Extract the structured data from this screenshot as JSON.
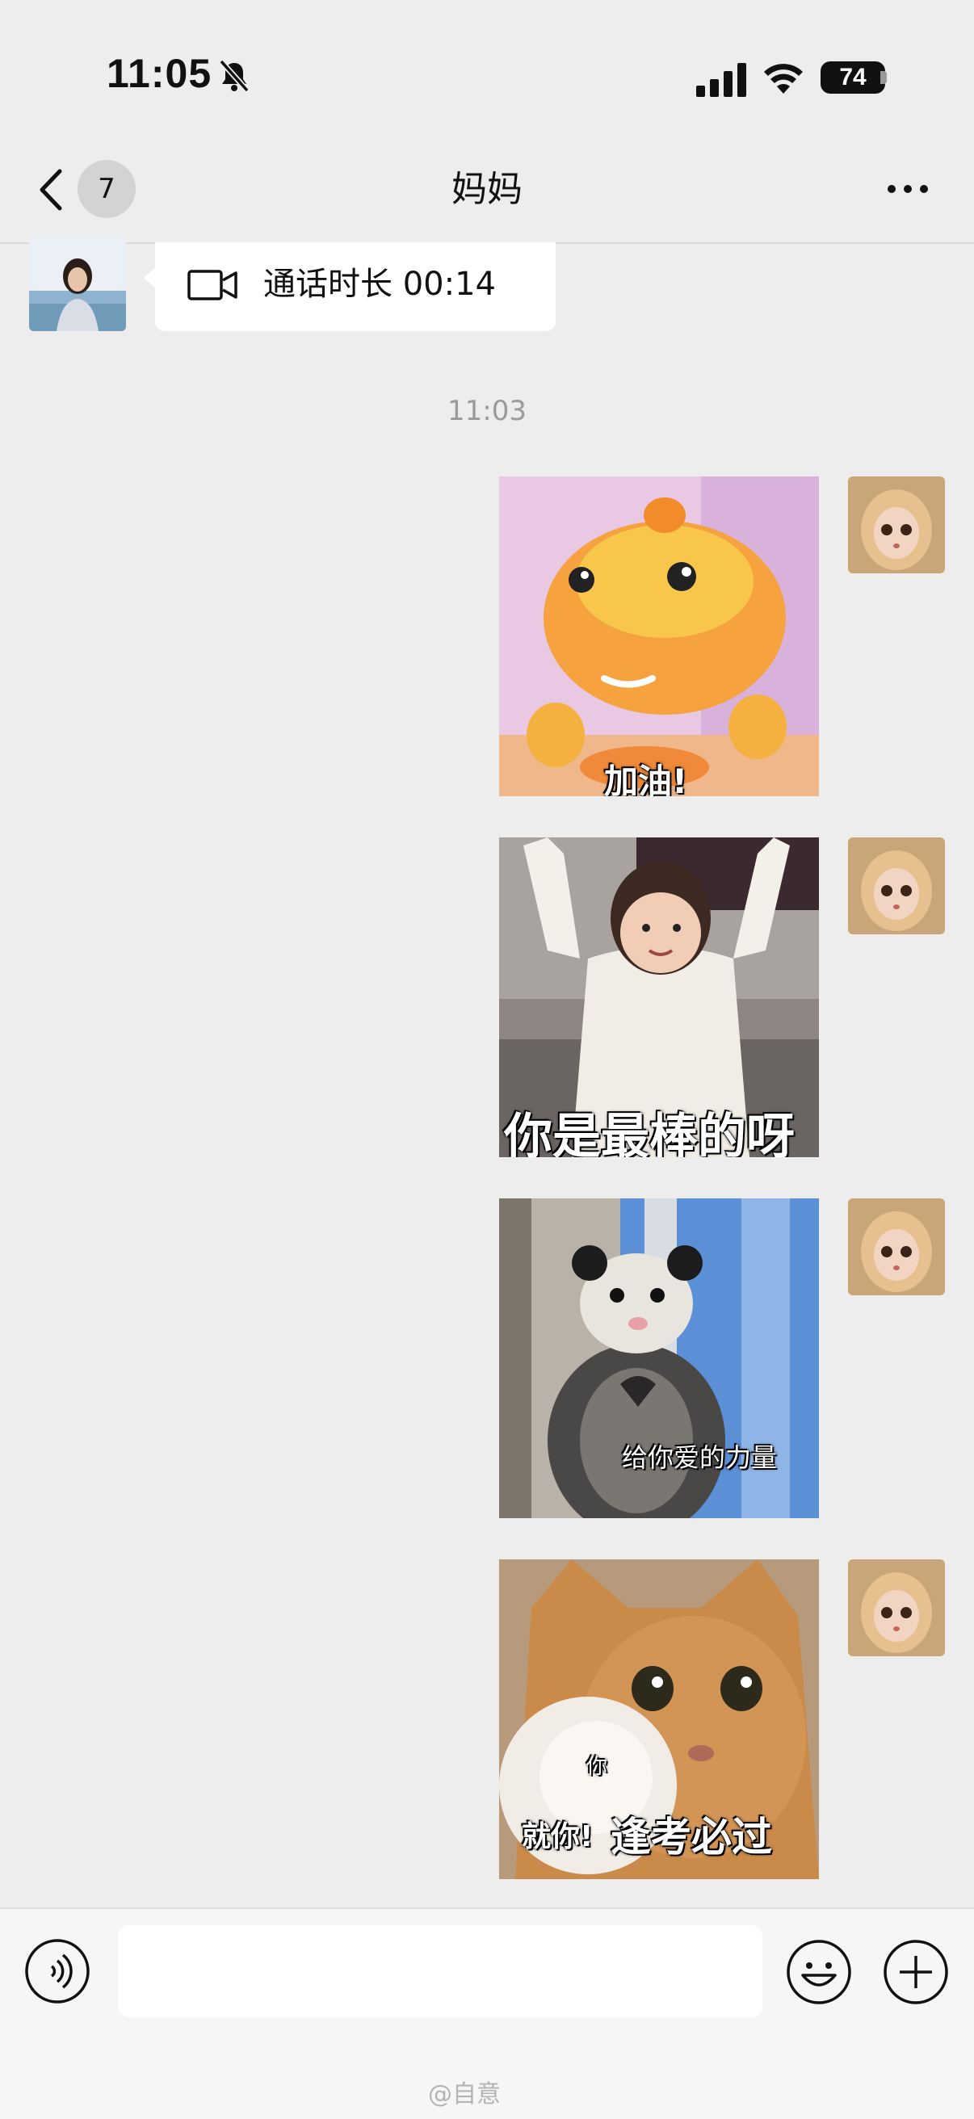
{
  "status_bar": {
    "time": "11:05",
    "battery": "74"
  },
  "header": {
    "unread_badge": "7",
    "title": "妈妈"
  },
  "messages": {
    "call_record": {
      "text": "通话时长 00:14"
    },
    "timestamp": "11:03",
    "stickers": [
      {
        "caption": "加油!"
      },
      {
        "caption": "你是最棒的呀"
      },
      {
        "caption": "给你爱的力量"
      },
      {
        "caption_small": "你",
        "caption_a": "就你!",
        "caption_b": "逢考必过"
      }
    ]
  },
  "input_bar": {
    "placeholder": ""
  },
  "watermark": "@自意",
  "colors": {
    "background": "#ededed",
    "bubble_in": "#ffffff",
    "timestamp": "#9a9a9a"
  }
}
